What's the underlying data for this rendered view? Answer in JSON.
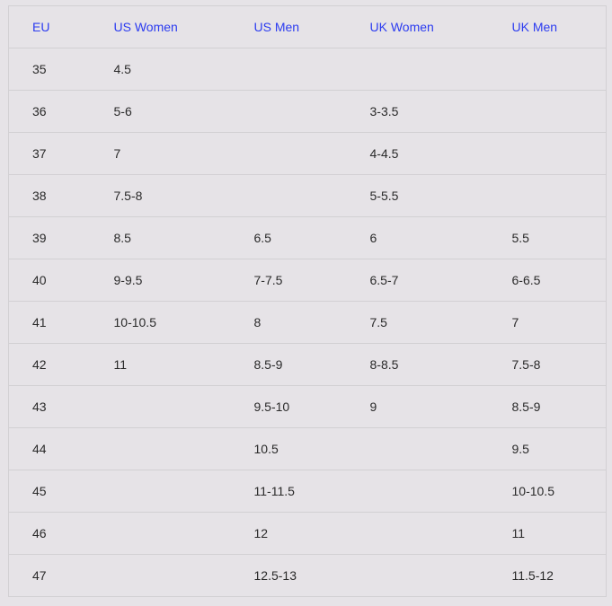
{
  "table": {
    "headers": [
      "EU",
      "US Women",
      "US Men",
      "UK Women",
      "UK Men"
    ],
    "rows": [
      [
        "35",
        "4.5",
        "",
        "",
        ""
      ],
      [
        "36",
        "5-6",
        "",
        "3-3.5",
        ""
      ],
      [
        "37",
        "7",
        "",
        "4-4.5",
        ""
      ],
      [
        "38",
        "7.5-8",
        "",
        "5-5.5",
        ""
      ],
      [
        "39",
        "8.5",
        "6.5",
        "6",
        "5.5"
      ],
      [
        "40",
        "9-9.5",
        "7-7.5",
        "6.5-7",
        "6-6.5"
      ],
      [
        "41",
        "10-10.5",
        "8",
        "7.5",
        "7"
      ],
      [
        "42",
        "11",
        "8.5-9",
        "8-8.5",
        "7.5-8"
      ],
      [
        "43",
        "",
        "9.5-10",
        "9",
        "8.5-9"
      ],
      [
        "44",
        "",
        "10.5",
        "",
        "9.5"
      ],
      [
        "45",
        "",
        "11-11.5",
        "",
        "10-10.5"
      ],
      [
        "46",
        "",
        "12",
        "",
        "11"
      ],
      [
        "47",
        "",
        "12.5-13",
        "",
        "11.5-12"
      ]
    ]
  },
  "colors": {
    "background": "#e6e3e7",
    "border": "#d2d0d3",
    "header_text": "#2b3bf0",
    "body_text": "#2a2a2a"
  }
}
